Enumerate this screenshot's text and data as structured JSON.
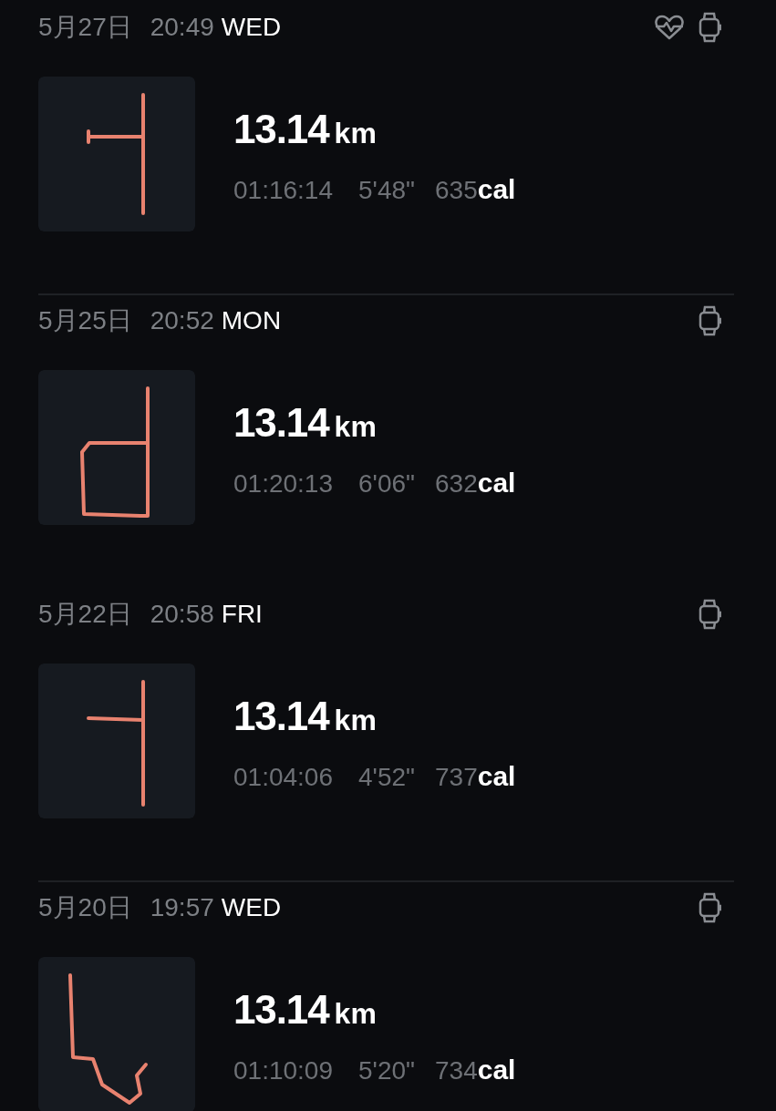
{
  "workouts": [
    {
      "date": "5月27日",
      "time": "20:49",
      "weekday": "WED",
      "heart_rate": true,
      "distance": "13.14",
      "distance_unit": "km",
      "duration": "01:16:14",
      "pace": "5'48\"",
      "calories": "635",
      "calories_unit": "cal",
      "divider_above": false
    },
    {
      "date": "5月25日",
      "time": "20:52",
      "weekday": "MON",
      "heart_rate": false,
      "distance": "13.14",
      "distance_unit": "km",
      "duration": "01:20:13",
      "pace": "6'06\"",
      "calories": "632",
      "calories_unit": "cal",
      "divider_above": true
    },
    {
      "date": "5月22日",
      "time": "20:58",
      "weekday": "FRI",
      "heart_rate": false,
      "distance": "13.14",
      "distance_unit": "km",
      "duration": "01:04:06",
      "pace": "4'52\"",
      "calories": "737",
      "calories_unit": "cal",
      "divider_above": false
    },
    {
      "date": "5月20日",
      "time": "19:57",
      "weekday": "WED",
      "heart_rate": false,
      "distance": "13.14",
      "distance_unit": "km",
      "duration": "01:10:09",
      "pace": "5'20\"",
      "calories": "734",
      "calories_unit": "cal",
      "divider_above": true
    }
  ]
}
